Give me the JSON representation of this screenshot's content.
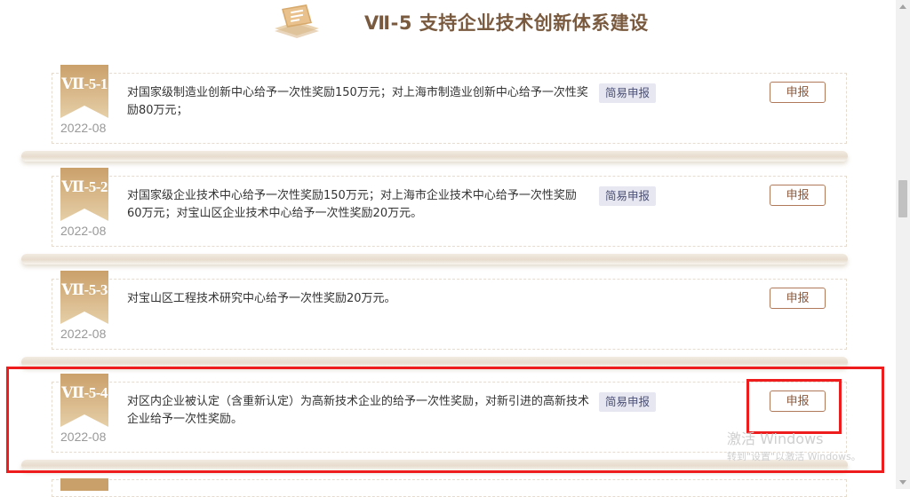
{
  "header": {
    "icon": "certificate-stack-icon",
    "title": "Ⅶ-5 支持企业技术创新体系建设"
  },
  "items": [
    {
      "code": "Ⅶ-5-1",
      "date": "2022-08",
      "description": "对国家级制造业创新中心给予一次性奖励150万元；对上海市制造业创新中心给予一次性奖励80万元；",
      "tag": "简易申报",
      "button": "申报"
    },
    {
      "code": "Ⅶ-5-2",
      "date": "2022-08",
      "description": "对国家级企业技术中心给予一次性奖励150万元；对上海市企业技术中心给予一次性奖励60万元；对宝山区企业技术中心给予一次性奖励20万元。",
      "tag": "简易申报",
      "button": "申报"
    },
    {
      "code": "Ⅶ-5-3",
      "date": "2022-08",
      "description": "对宝山区工程技术研究中心给予一次性奖励20万元。",
      "tag": "",
      "button": "申报"
    },
    {
      "code": "Ⅶ-5-4",
      "date": "2022-08",
      "description": "对区内企业被认定（含重新认定）为高新技术企业的给予一次性奖励，对新引进的高新技术企业给予一次性奖励。",
      "tag": "简易申报",
      "button": "申报"
    }
  ],
  "watermark": {
    "line1": "激活 Windows",
    "line2": "转到\"设置\"以激活 Windows。"
  },
  "colors": {
    "title": "#7a5a3f",
    "ribbon": "#c9a36f",
    "button_border": "#b07a5a",
    "tag_bg": "#e7e7f1",
    "highlight": "#ee1c1c"
  }
}
